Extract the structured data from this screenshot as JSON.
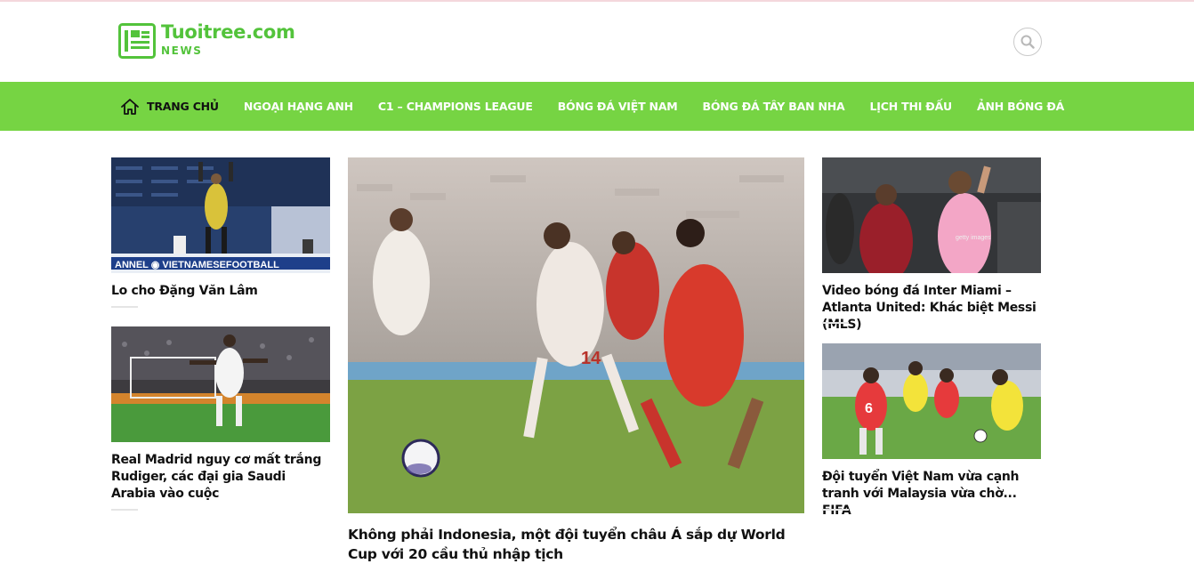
{
  "site": {
    "name": "Tuoitree.com",
    "tagline": "NEWS"
  },
  "colors": {
    "brand_green": "#53c33b",
    "nav_green": "#76d443",
    "text": "#111111"
  },
  "nav": {
    "items": [
      {
        "label": "TRANG CHỦ",
        "icon": "home-icon",
        "active": true
      },
      {
        "label": "NGOẠI HẠNG ANH"
      },
      {
        "label": "C1 – CHAMPIONS LEAGUE"
      },
      {
        "label": "BÓNG ĐÁ VIỆT NAM"
      },
      {
        "label": "BÓNG ĐÁ TÂY BAN NHA"
      },
      {
        "label": "LỊCH THI ĐẤU"
      },
      {
        "label": "ẢNH BÓNG ĐÁ"
      }
    ]
  },
  "articles": {
    "left_top": {
      "title": "Lo cho Đặng Văn Lâm"
    },
    "left_bottom": {
      "title": "Real Madrid nguy cơ mất trắng Rudiger, các đại gia Saudi Arabia vào cuộc"
    },
    "featured": {
      "title": "Không phải Indonesia, một đội tuyển châu Á sắp dự World Cup với 20 cầu thủ nhập tịch"
    },
    "right_top": {
      "title": "Video bóng đá Inter Miami – Atlanta United: Khác biệt Messi (MLS)"
    },
    "right_bottom": {
      "title": "Đội tuyển Việt Nam vừa cạnh tranh với Malaysia vừa chờ... FIFA"
    }
  }
}
